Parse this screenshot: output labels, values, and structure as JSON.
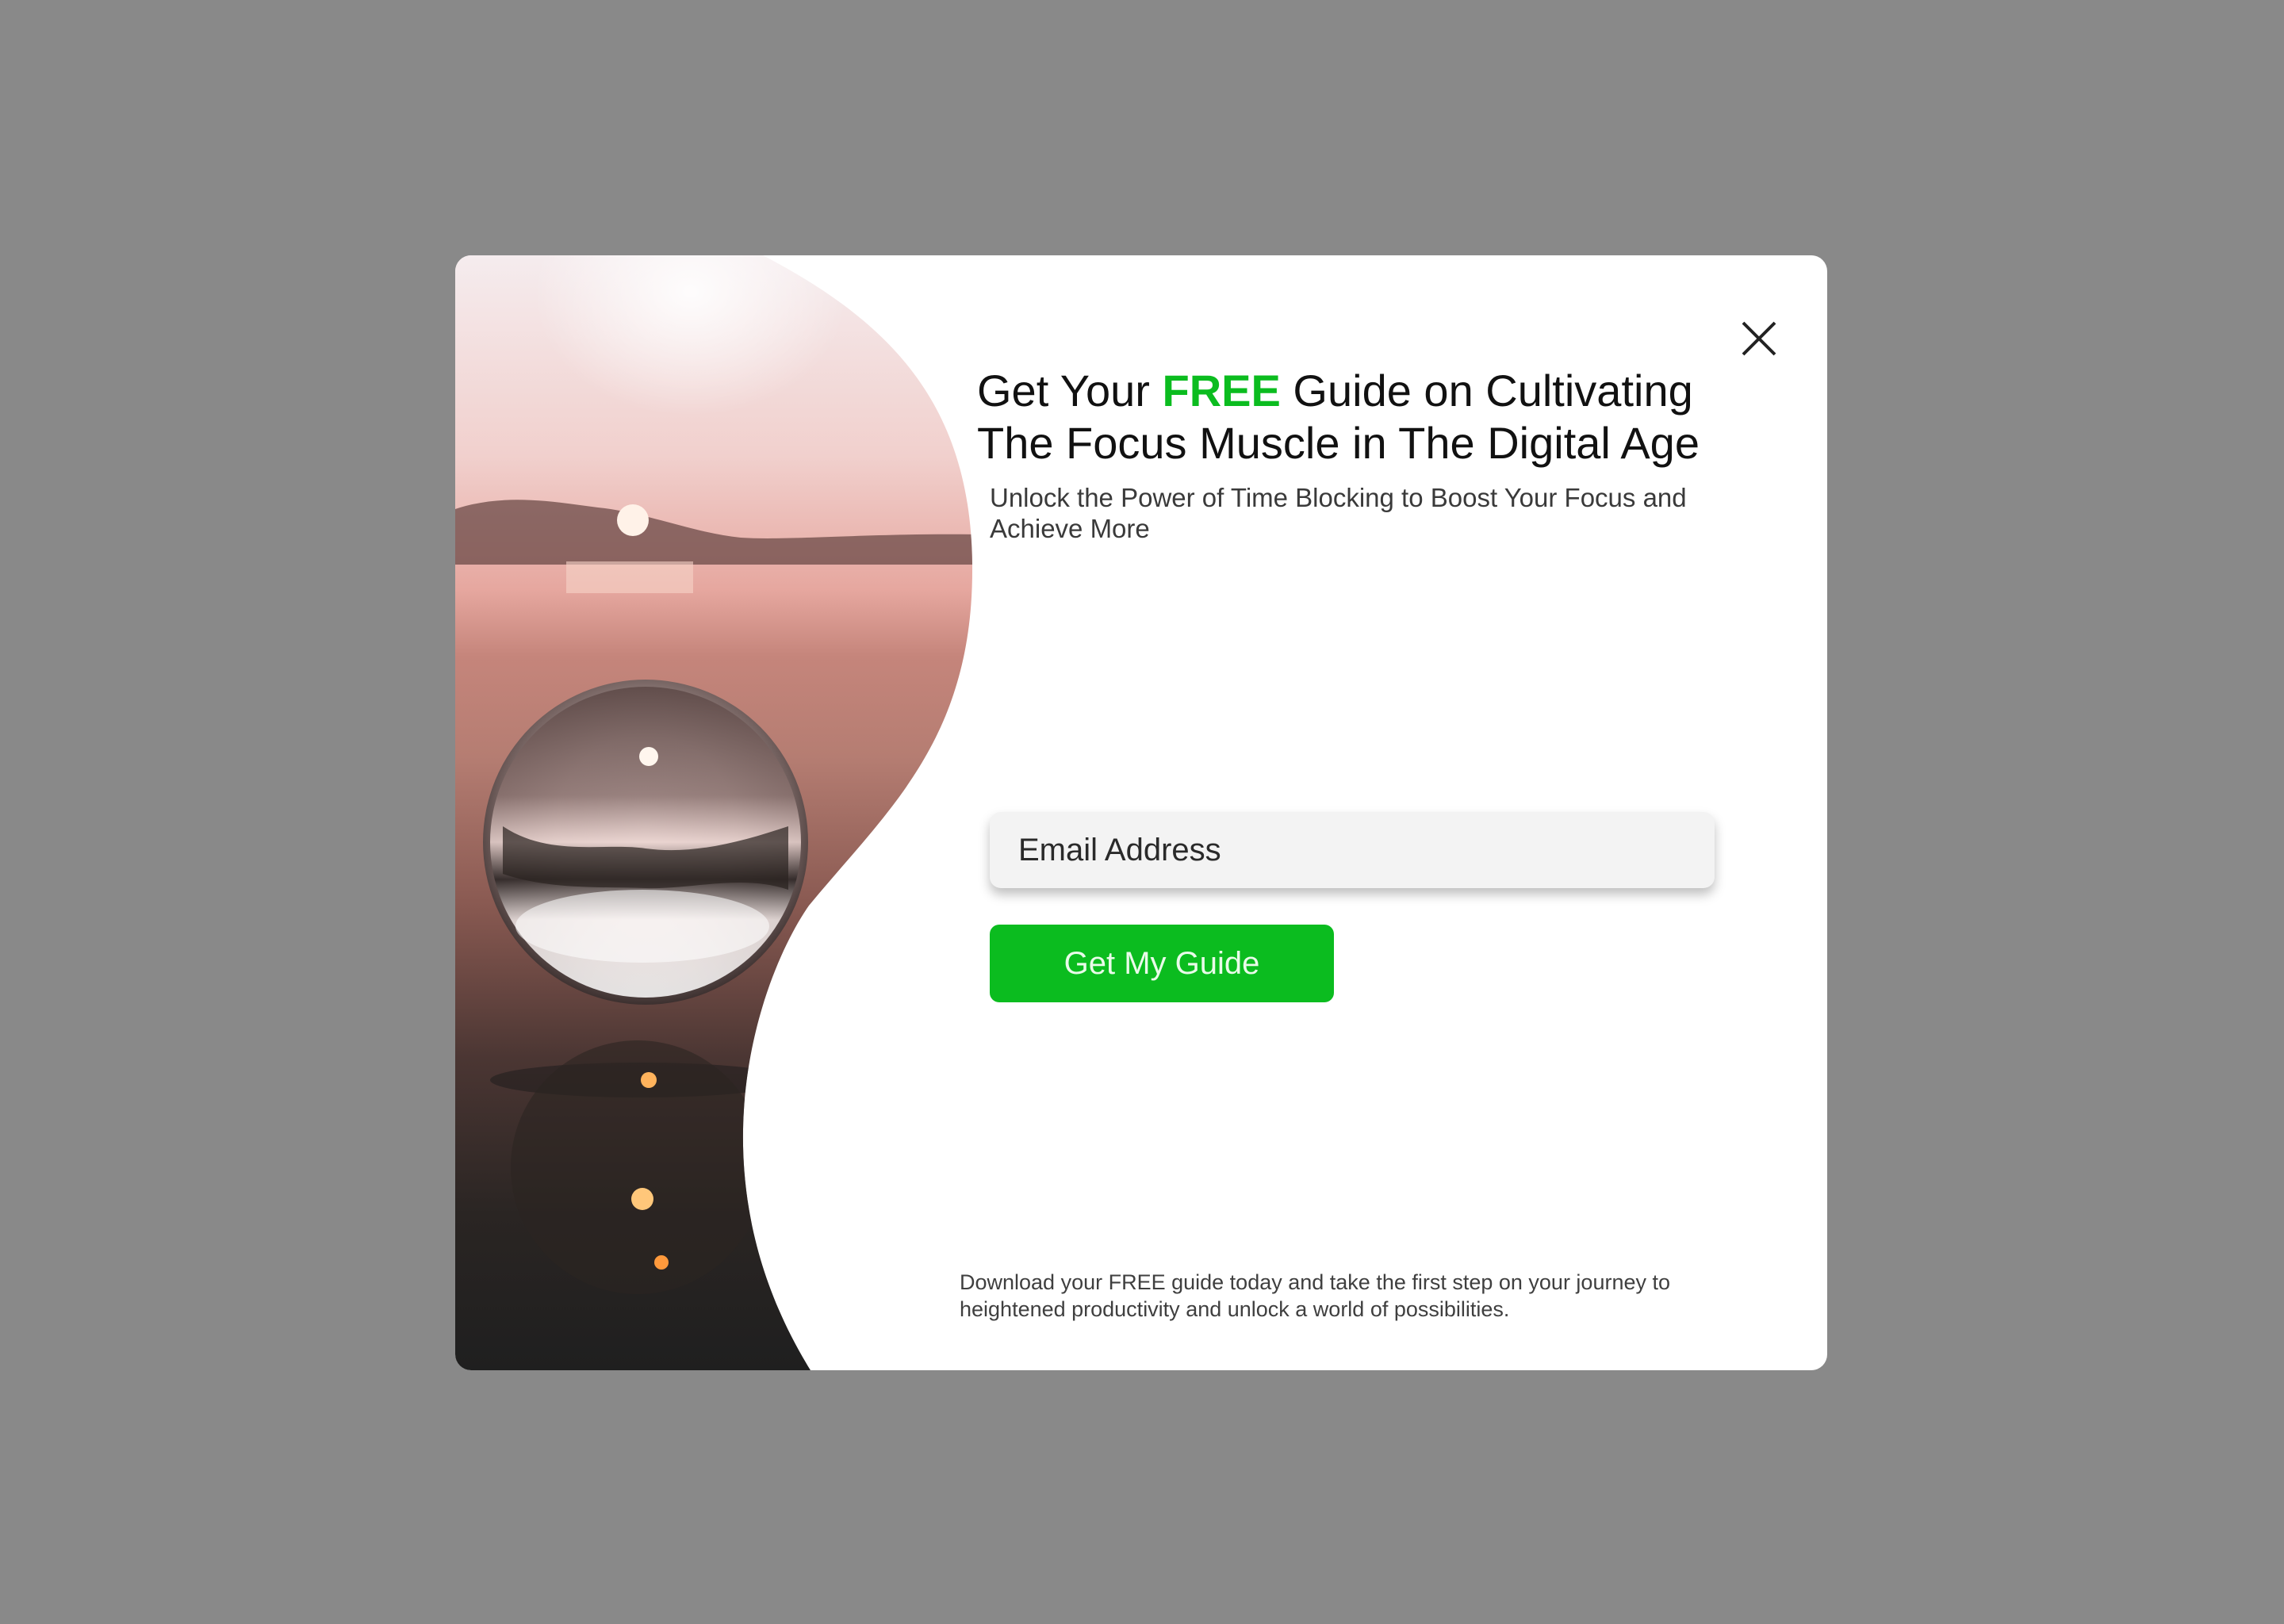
{
  "modal": {
    "close_icon": "close-icon",
    "hero_image": "crystal-ball-sunset-beach-photo",
    "headline": {
      "part1": "Get Your ",
      "accent": "FREE",
      "part2": " Guide on Cultivating The Focus Muscle in The Digital Age"
    },
    "subheadline": "Unlock the Power of Time Blocking to Boost Your Focus and Achieve More",
    "email": {
      "placeholder": "Email Address",
      "value": ""
    },
    "cta_label": "Get My Guide",
    "footer": "Download your FREE guide today and take the first step on your journey to heightened productivity and unlock a world of possibilities."
  },
  "colors": {
    "page_background": "#898989",
    "modal_background": "#ffffff",
    "accent": "#0bbc1f",
    "text": "#111111"
  }
}
